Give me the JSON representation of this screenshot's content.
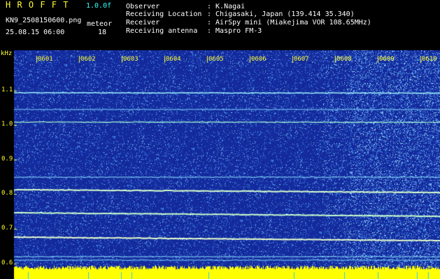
{
  "header": {
    "program": "H R O F F T",
    "version": "1.0.0f",
    "filename": "KN9_2508150600.png",
    "datetime": "25.08.15 06:00",
    "mode_label": "meteor",
    "mode_value": "18",
    "fields": [
      {
        "label": "Observer",
        "value": ": K.Nagai"
      },
      {
        "label": "Receiving Location",
        "value": ": Chigasaki, Japan (139.414 35.340)"
      },
      {
        "label": "Receiver",
        "value": ": AirSpy mini (Miakejima VOR 108.65MHz)"
      },
      {
        "label": "Receiving antenna",
        "value": ": Maspro FM-3"
      }
    ]
  },
  "chart_data": {
    "type": "heatmap",
    "ylabel": "kHz",
    "y_ticks": [
      "1.1",
      "1.0",
      "0.9",
      "0.8",
      "0.7",
      "0.6"
    ],
    "x_ticks": [
      "0601",
      "0602",
      "0603",
      "0604",
      "0605",
      "0606",
      "0607",
      "0608",
      "0609",
      "0610"
    ],
    "ylim": [
      0.58,
      1.16
    ],
    "colors": {
      "background": "#1a2a9a",
      "noise_bright": "#4aa8ff",
      "line": "#ccffdd",
      "band": "#ffff00"
    }
  }
}
